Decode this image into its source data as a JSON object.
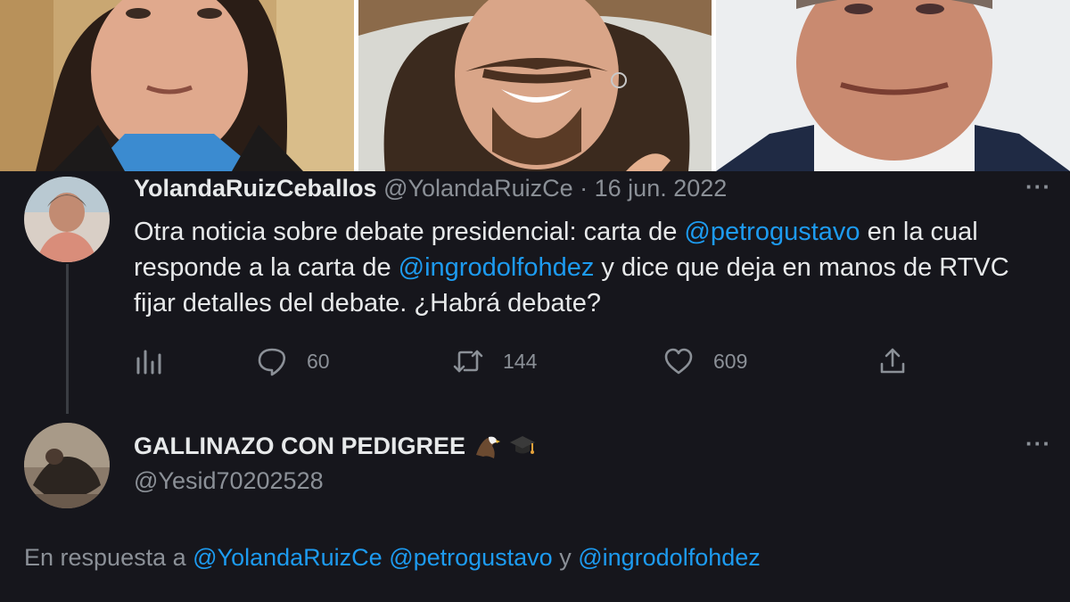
{
  "photos": [
    {
      "subject": "portrait-man-long-hair-blue-shirt"
    },
    {
      "subject": "portrait-man-mustache-cowboy-hat"
    },
    {
      "subject": "portrait-man-smiling-suit"
    }
  ],
  "tweet": {
    "display_name": "YolandaRuizCeballos",
    "handle": "@YolandaRuizCe",
    "separator": "·",
    "date": "16 jun. 2022",
    "more_icon": "more-horizontal-icon",
    "text": {
      "p1": "Otra noticia sobre debate presidencial: carta de ",
      "m1": "@petrogustavo",
      "p2": " en la cual responde a la carta de ",
      "m2": "@ingrodolfohdez",
      "p3": " y dice que deja en manos de RTVC fijar detalles del debate. ¿Habrá debate?"
    },
    "actions": {
      "analytics_icon": "analytics-icon",
      "reply_icon": "reply-icon",
      "reply_count": "60",
      "retweet_icon": "retweet-icon",
      "retweet_count": "144",
      "like_icon": "heart-icon",
      "like_count": "609",
      "share_icon": "share-icon"
    }
  },
  "reply": {
    "display_name": "GALLINAZO CON PEDIGREE",
    "emojis": [
      "eagle-emoji",
      "graduation-cap-emoji"
    ],
    "handle": "@Yesid70202528",
    "replying_prefix": "En respuesta a ",
    "replying_to": [
      "@YolandaRuizCe",
      "@petrogustavo",
      "@ingrodolfohdez"
    ],
    "replying_joiner": " y "
  },
  "colors": {
    "background": "#16161c",
    "text": "#e7e9ea",
    "secondary": "#8b9097",
    "mention": "#1d9bf0"
  }
}
